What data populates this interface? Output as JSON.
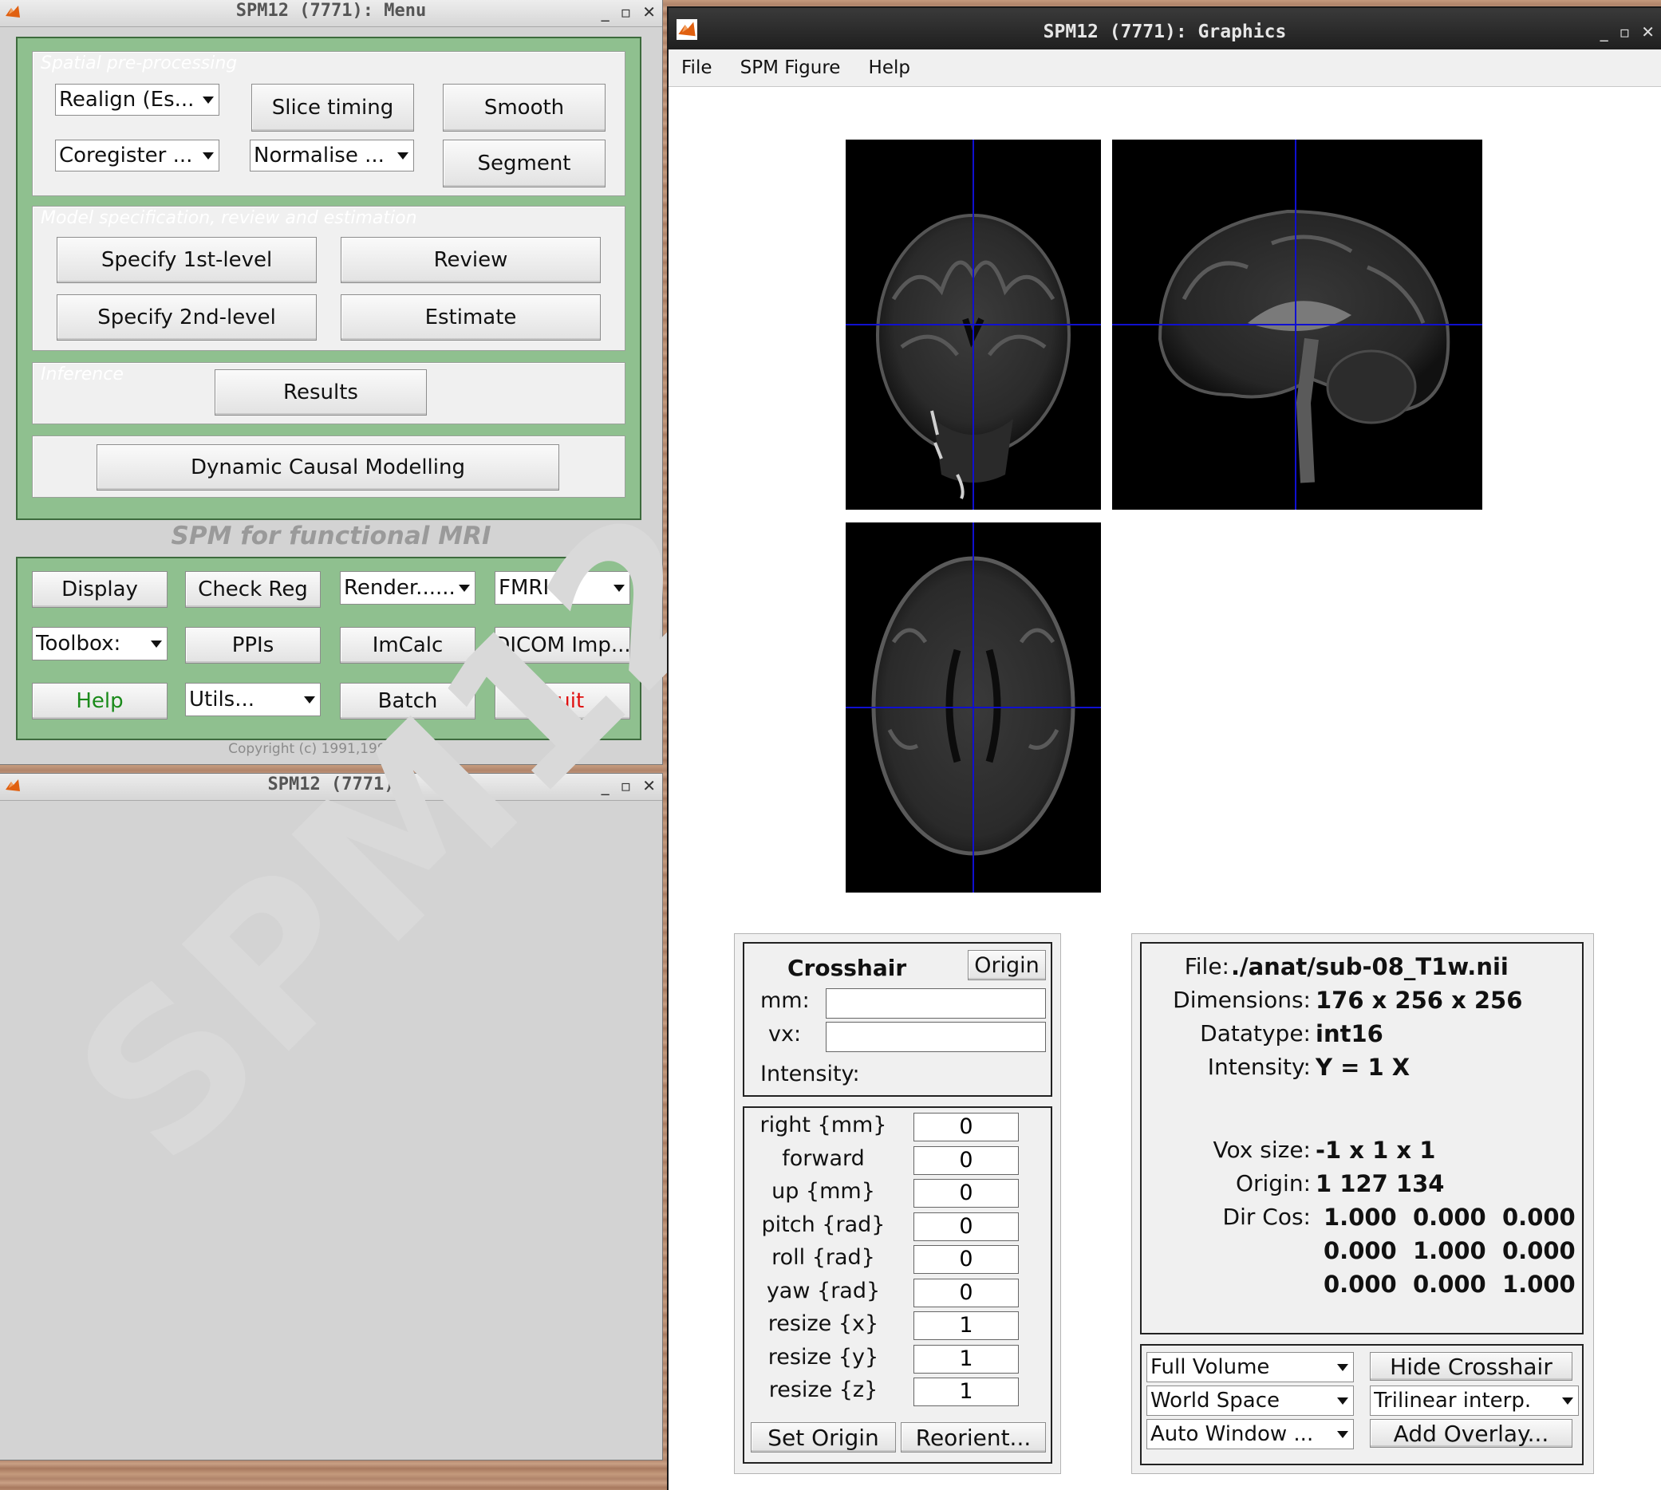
{
  "menu_window": {
    "title": "SPM12 (7771): Menu",
    "panels": {
      "spatial_title": "Spatial pre-processing",
      "model_title": "Model specification, review and estimation",
      "inference_title": "Inference"
    },
    "realign": "Realign (Es...",
    "slice_timing": "Slice timing",
    "smooth": "Smooth",
    "coregister": "Coregister ...",
    "normalise": "Normalise ...",
    "segment": "Segment",
    "specify_1st": "Specify 1st-level",
    "review": "Review",
    "specify_2nd": "Specify 2nd-level",
    "estimate": "Estimate",
    "results": "Results",
    "dcm": "Dynamic Causal Modelling",
    "subtitle": "SPM for functional MRI",
    "display": "Display",
    "check_reg": "Check Reg",
    "render": "Render......",
    "fmri": "FMRI",
    "toolbox": "Toolbox:",
    "ppis": "PPIs",
    "imcalc": "ImCalc",
    "dicom": "DICOM Imp...",
    "help": "Help",
    "utils": "Utils...",
    "batch": "Batch",
    "quit": "Quit",
    "copyright": "Copyright (c) 1991,1994-2020",
    "colors": {
      "help": "#1a8a1a",
      "quit": "#e01010",
      "panel_green": "#8fc08f"
    }
  },
  "blank_window": {
    "title": "SPM12 (7771)",
    "watermark": "SPM12"
  },
  "graphics_window": {
    "title": "SPM12 (7771): Graphics",
    "menu": [
      "File",
      "SPM Figure",
      "Help"
    ],
    "crosshair": {
      "heading": "Crosshair",
      "origin_button": "Origin",
      "mm_label": "mm:",
      "vx_label": "vx:",
      "mm_value": "",
      "vx_value": "",
      "intensity_label": "Intensity:"
    },
    "params": [
      {
        "label": "right  {mm}",
        "value": "0"
      },
      {
        "label": "forward",
        "value": "0"
      },
      {
        "label": "up  {mm}",
        "value": "0"
      },
      {
        "label": "pitch  {rad}",
        "value": "0"
      },
      {
        "label": "roll  {rad}",
        "value": "0"
      },
      {
        "label": "yaw  {rad}",
        "value": "0"
      },
      {
        "label": "resize  {x}",
        "value": "1"
      },
      {
        "label": "resize  {y}",
        "value": "1"
      },
      {
        "label": "resize  {z}",
        "value": "1"
      }
    ],
    "set_origin": "Set Origin",
    "reorient": "Reorient...",
    "info": {
      "file_k": "File:",
      "file_v": "./anat/sub-08_T1w.nii",
      "dims_k": "Dimensions:",
      "dims_v": "176 x 256 x 256",
      "dtype_k": "Datatype:",
      "dtype_v": "int16",
      "int_k": "Intensity:",
      "int_v": "Y  = 1 X",
      "vox_k": "Vox size:",
      "vox_v": "-1 x 1 x 1",
      "origin_k": "Origin:",
      "origin_v": "1 127 134",
      "dircos_k": "Dir Cos:",
      "dircos_rows": [
        [
          "1.000",
          "0.000",
          "0.000"
        ],
        [
          "0.000",
          "1.000",
          "0.000"
        ],
        [
          "0.000",
          "0.000",
          "1.000"
        ]
      ]
    },
    "full_volume": "Full Volume",
    "hide_crosshair": "Hide Crosshair",
    "world_space": "World Space",
    "trilinear": "Trilinear interp.",
    "auto_window": "Auto Window ...",
    "add_overlay": "Add Overlay...",
    "crosshair_color": "#1010d0"
  }
}
